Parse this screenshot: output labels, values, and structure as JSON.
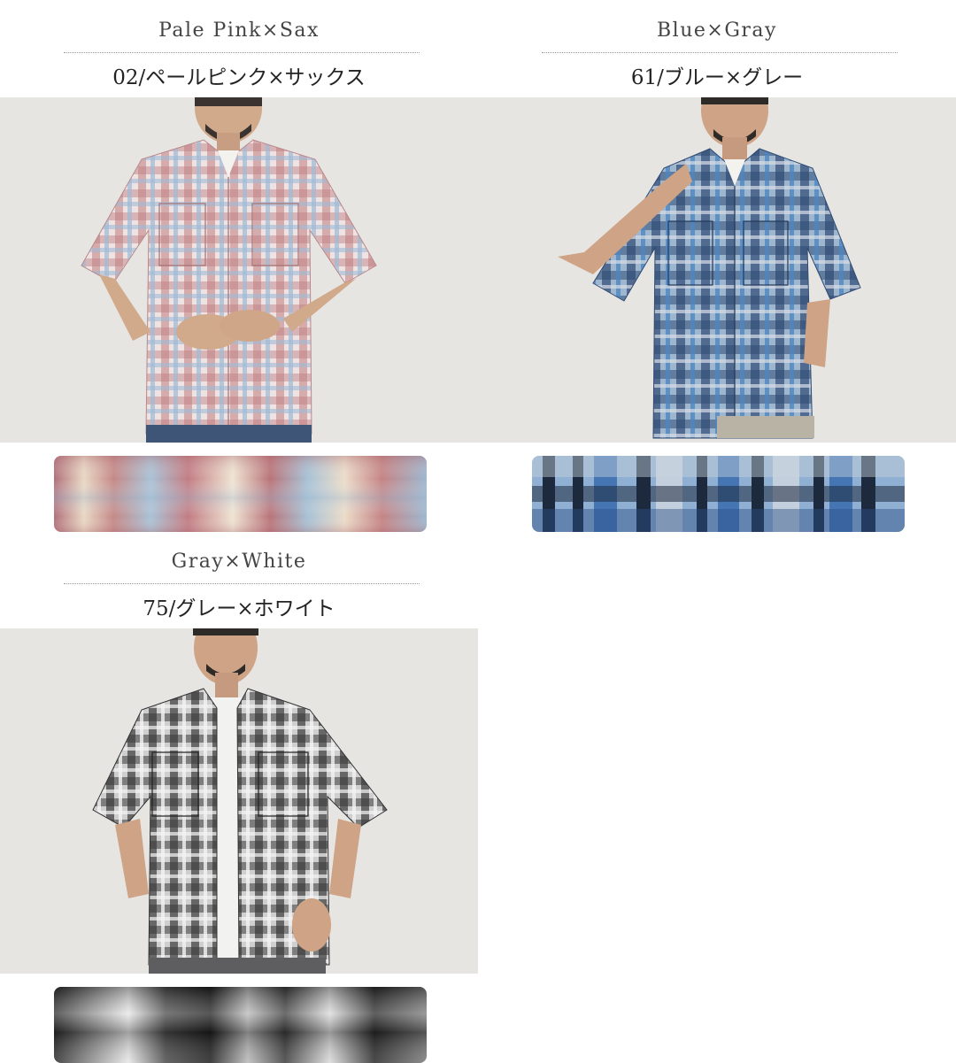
{
  "variants": [
    {
      "en_name": "Pale Pink×Sax",
      "jp_name": "02/ペールピンク×サックス"
    },
    {
      "en_name": "Blue×Gray",
      "jp_name": "61/ブルー×グレー"
    },
    {
      "en_name": "Gray×White",
      "jp_name": "75/グレー×ホワイト"
    }
  ],
  "colors": {
    "pink_check": [
      "#b86e72",
      "#d9a6a4",
      "#a6c0d8",
      "#f1e7e4"
    ],
    "blue_check": [
      "#2c3a55",
      "#4c7eb8",
      "#9fb9d4",
      "#d7dee6"
    ],
    "gray_check": [
      "#2a2a2a",
      "#6e6e6e",
      "#b9b9b9",
      "#efefef"
    ]
  }
}
